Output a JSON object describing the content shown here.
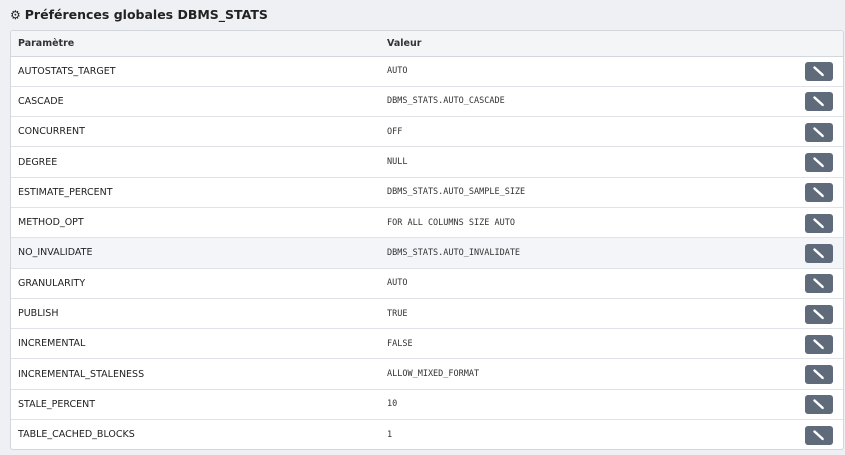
{
  "header": {
    "icon": "gear-icon",
    "title": "Préférences globales DBMS_STATS"
  },
  "table": {
    "columns": [
      "Paramètre",
      "Valeur",
      ""
    ],
    "rows": [
      {
        "param": "AUTOSTATS_TARGET",
        "value": "AUTO"
      },
      {
        "param": "CASCADE",
        "value": "DBMS_STATS.AUTO_CASCADE"
      },
      {
        "param": "CONCURRENT",
        "value": "OFF"
      },
      {
        "param": "DEGREE",
        "value": "NULL"
      },
      {
        "param": "ESTIMATE_PERCENT",
        "value": "DBMS_STATS.AUTO_SAMPLE_SIZE"
      },
      {
        "param": "METHOD_OPT",
        "value": "FOR ALL COLUMNS SIZE AUTO"
      },
      {
        "param": "NO_INVALIDATE",
        "value": "DBMS_STATS.AUTO_INVALIDATE"
      },
      {
        "param": "GRANULARITY",
        "value": "AUTO"
      },
      {
        "param": "PUBLISH",
        "value": "TRUE"
      },
      {
        "param": "INCREMENTAL",
        "value": "FALSE"
      },
      {
        "param": "INCREMENTAL_STALENESS",
        "value": "ALLOW_MIXED_FORMAT"
      },
      {
        "param": "STALE_PERCENT",
        "value": "10"
      },
      {
        "param": "TABLE_CACHED_BLOCKS",
        "value": "1"
      }
    ],
    "highlighted_row": 6,
    "row_action_icon": "pencil-icon"
  },
  "colors": {
    "button": "#5f6b7b",
    "row_highlight": "#f3f5f9",
    "background": "#eef0f3"
  }
}
